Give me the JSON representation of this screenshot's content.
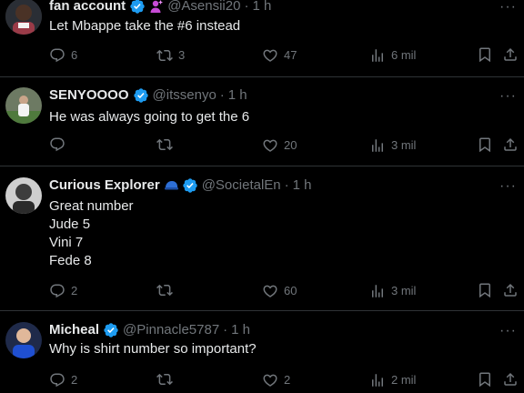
{
  "posts": [
    {
      "name": "fan account",
      "handle": "@Asensii20",
      "dot": "·",
      "time": "1 h",
      "text_lines": [
        "Let Mbappe take the #6 instead"
      ],
      "replies": "6",
      "reposts": "3",
      "likes": "47",
      "views": "6 mil",
      "more": "···"
    },
    {
      "name": "SENYOOOO",
      "handle": "@itssenyo",
      "dot": "·",
      "time": "1 h",
      "text_lines": [
        "He was always going to get the 6"
      ],
      "replies": "",
      "reposts": "",
      "likes": "20",
      "views": "3 mil",
      "more": "···"
    },
    {
      "name": "Curious Explorer",
      "handle": "@SocietalEn",
      "dot": "·",
      "time": "1 h",
      "text_lines": [
        "Great number",
        "Jude 5",
        "Vini 7",
        "Fede 8"
      ],
      "replies": "2",
      "reposts": "",
      "likes": "60",
      "views": "3 mil",
      "more": "···"
    },
    {
      "name": "Micheal",
      "handle": "@Pinnacle5787",
      "dot": "·",
      "time": "1 h",
      "text_lines": [
        "Why is shirt number so important?"
      ],
      "replies": "2",
      "reposts": "",
      "likes": "2",
      "views": "2 mil",
      "more": "···"
    }
  ],
  "colors": {
    "background": "#000000",
    "text": "#e7e9ea",
    "muted": "#71767b",
    "verified": "#1d9bf0",
    "divider": "#2f3336"
  }
}
